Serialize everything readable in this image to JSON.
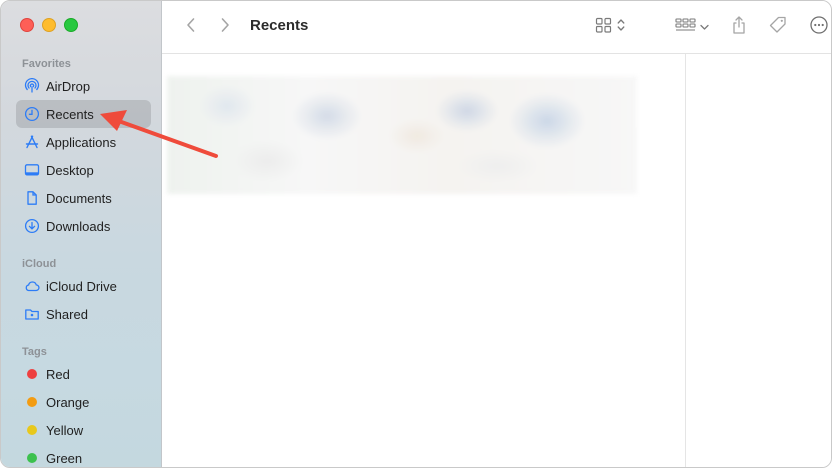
{
  "window": {
    "title": "Recents"
  },
  "sidebar": {
    "favorites": {
      "title": "Favorites",
      "items": [
        {
          "label": "AirDrop",
          "icon": "airdrop-icon"
        },
        {
          "label": "Recents",
          "icon": "clock-icon",
          "selected": true
        },
        {
          "label": "Applications",
          "icon": "applications-icon"
        },
        {
          "label": "Desktop",
          "icon": "desktop-icon"
        },
        {
          "label": "Documents",
          "icon": "document-icon"
        },
        {
          "label": "Downloads",
          "icon": "download-icon"
        }
      ]
    },
    "icloud": {
      "title": "iCloud",
      "items": [
        {
          "label": "iCloud Drive",
          "icon": "cloud-icon"
        },
        {
          "label": "Shared",
          "icon": "shared-folder-icon"
        }
      ]
    },
    "tags": {
      "title": "Tags",
      "items": [
        {
          "label": "Red",
          "color": "#ee4040"
        },
        {
          "label": "Orange",
          "color": "#f39c12"
        },
        {
          "label": "Yellow",
          "color": "#e8c81c"
        },
        {
          "label": "Green",
          "color": "#3cc14e"
        }
      ]
    }
  },
  "toolbar": {
    "icons": [
      "chevron-left-icon",
      "chevron-right-icon",
      "grid-view-icon",
      "group-by-icon",
      "share-icon",
      "tag-icon",
      "more-icon"
    ]
  },
  "accent": "#2d7cf6",
  "annotation_color": "#ef4b3b"
}
